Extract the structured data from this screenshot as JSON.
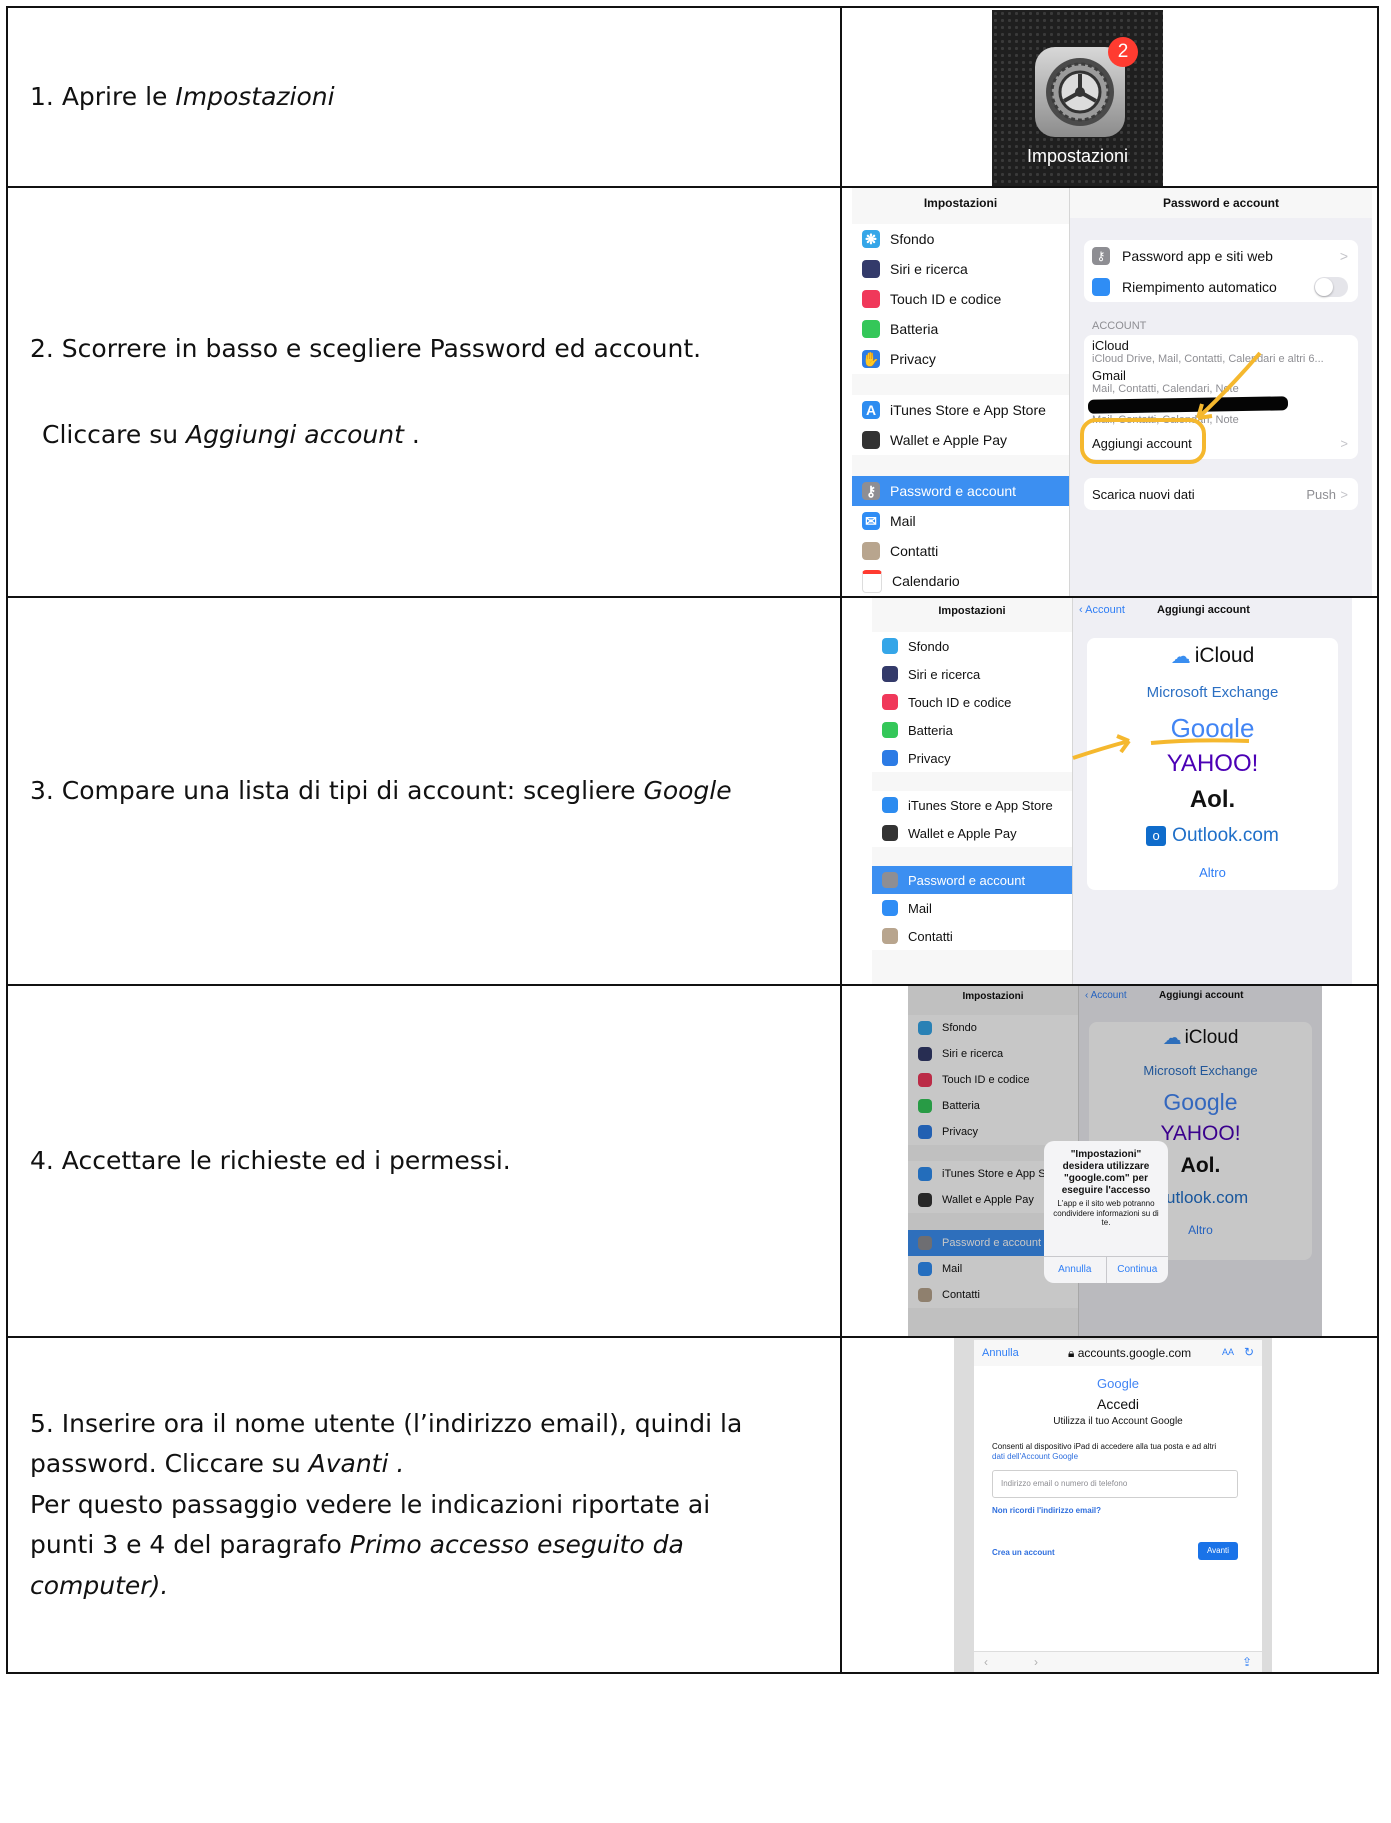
{
  "steps": [
    {
      "num": "1.",
      "text": "Aprire le",
      "italic": "Impostazioni"
    },
    {
      "line1": "2. Scorrere in basso e scegliere Password ed account.",
      "line2_pre": "Cliccare su",
      "line2_italic": "Aggiungi account",
      "line2_post": "."
    },
    {
      "pre": "3. Compare una lista di tipi di account: scegliere",
      "italic": "Google"
    },
    {
      "text": "4. Accettare le richieste ed i permessi."
    },
    {
      "l1": "5. Inserire ora il nome utente (l’indirizzo email), quindi la",
      "l2_pre": "password. Cliccare su",
      "l2_italic": "Avanti .",
      "l3": "Per questo passaggio vedere le indicazioni riportate ai",
      "l4_pre": "punti 3 e 4 del paragrafo",
      "l4_italic": "Primo accesso eseguito da",
      "l5_italic": "computer)."
    }
  ],
  "app_icon": {
    "label": "Impostazioni",
    "badge": "2",
    "icon": "gear-icon"
  },
  "settings": {
    "title": "Impostazioni",
    "items": [
      "Sfondo",
      "Siri e ricerca",
      "Touch ID e codice",
      "Batteria",
      "Privacy",
      "iTunes Store e App Store",
      "Wallet e Apple Pay",
      "Password e account",
      "Mail",
      "Contatti",
      "Calendario"
    ],
    "colors": [
      "#35a6e8",
      "#333a6a",
      "#f0385a",
      "#34c759",
      "#2c7be5",
      "#2d8cf0",
      "#333333",
      "#8e8e93",
      "#2f8df5",
      "#b8a58e",
      "#ffffff"
    ]
  },
  "passwords_screen": {
    "title": "Password e account",
    "row1": "Password app e siti web",
    "row2": "Riempimento automatico",
    "section": "ACCOUNT",
    "icloud": "iCloud",
    "icloud_sub": "iCloud Drive, Mail, Contatti, Calendari e altri 6...",
    "gmail": "Gmail",
    "gmail_sub": "Mail, Contatti, Calendari, Note",
    "hidden_sub": "Mail, Contatti, Calendari, Note",
    "add": "Aggiungi account",
    "fetch": "Scarica nuovi dati",
    "fetch_val": "Push"
  },
  "add_account": {
    "back": "Account",
    "title": "Aggiungi account",
    "providers": [
      "iCloud",
      "Microsoft Exchange",
      "Google",
      "YAHOO!",
      "Aol.",
      "Outlook.com",
      "Altro"
    ]
  },
  "alert": {
    "title": "\"Impostazioni\" desidera utilizzare \"google.com\" per eseguire l'accesso",
    "message": "L'app e il sito web potranno condividere informazioni su di te.",
    "cancel": "Annulla",
    "continue": "Continua"
  },
  "google_signin": {
    "cancel": "Annulla",
    "url": "accounts.google.com",
    "aa": "AA",
    "logo": "Google",
    "title": "Accedi",
    "subtitle": "Utilizza il tuo Account Google",
    "consent": "Consenti al dispositivo iPad di accedere alla tua posta e ad altri",
    "consent_link": "dati dell'Account Google",
    "placeholder": "Indirizzo email o numero di telefono",
    "forgot": "Non ricordi l'indirizzo email?",
    "create": "Crea un account",
    "next": "Avanti"
  }
}
